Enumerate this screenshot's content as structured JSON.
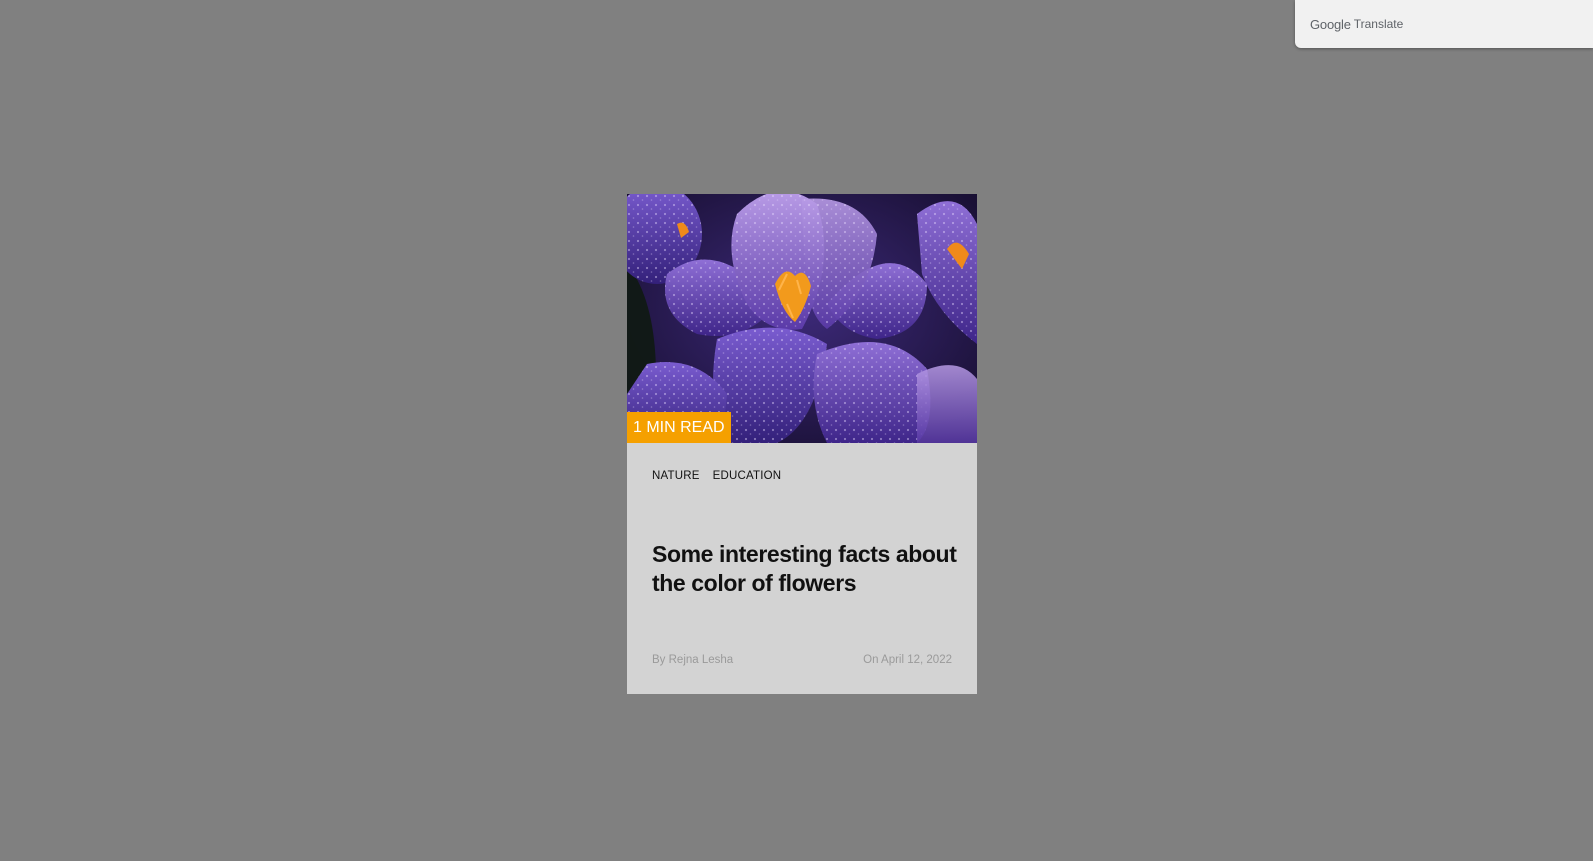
{
  "translate_bar": {
    "google": "Google",
    "translate": "Translate"
  },
  "card": {
    "badge": "1 MIN READ",
    "tags": [
      "NATURE",
      "EDUCATION"
    ],
    "title": "Some interesting facts about the color of flowers",
    "author": "By Rejna Lesha",
    "date": "On April 12, 2022",
    "image_icon": "crocus-flower-photo",
    "accent_color": "#f5a000"
  }
}
